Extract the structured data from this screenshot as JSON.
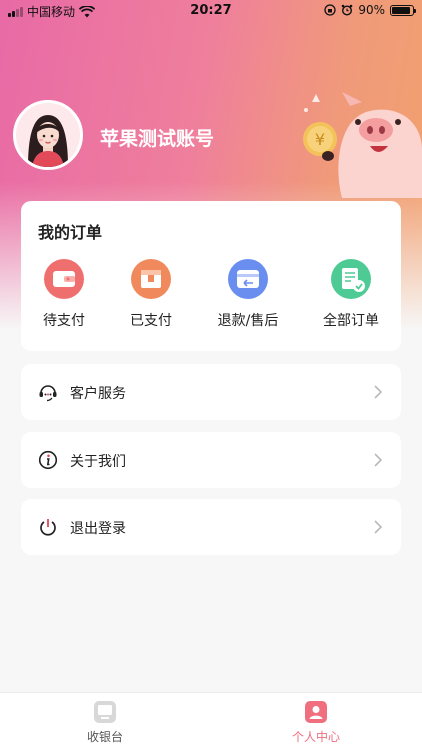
{
  "status_bar": {
    "carrier": "中国移动",
    "time": "20:27",
    "battery": "90%",
    "battery_level": 0.9
  },
  "profile": {
    "username": "苹果测试账号"
  },
  "orders": {
    "title": "我的订单",
    "items": [
      {
        "label": "待支付",
        "icon": "wallet-icon",
        "color": "#ef6f6f"
      },
      {
        "label": "已支付",
        "icon": "paid-box-icon",
        "color": "#f08a5c"
      },
      {
        "label": "退款/售后",
        "icon": "refund-icon",
        "color": "#6a8ef0"
      },
      {
        "label": "全部订单",
        "icon": "all-orders-icon",
        "color": "#4ecb94"
      }
    ]
  },
  "menu": [
    {
      "label": "客户服务",
      "icon": "customer-service-icon"
    },
    {
      "label": "关于我们",
      "icon": "info-icon"
    },
    {
      "label": "退出登录",
      "icon": "power-icon"
    }
  ],
  "tabbar": {
    "tabs": [
      {
        "label": "收银台",
        "icon": "cashier-icon",
        "active": false
      },
      {
        "label": "个人中心",
        "icon": "profile-icon",
        "active": true
      }
    ],
    "active_color": "#ef6f7f",
    "inactive_color": "#555555"
  }
}
